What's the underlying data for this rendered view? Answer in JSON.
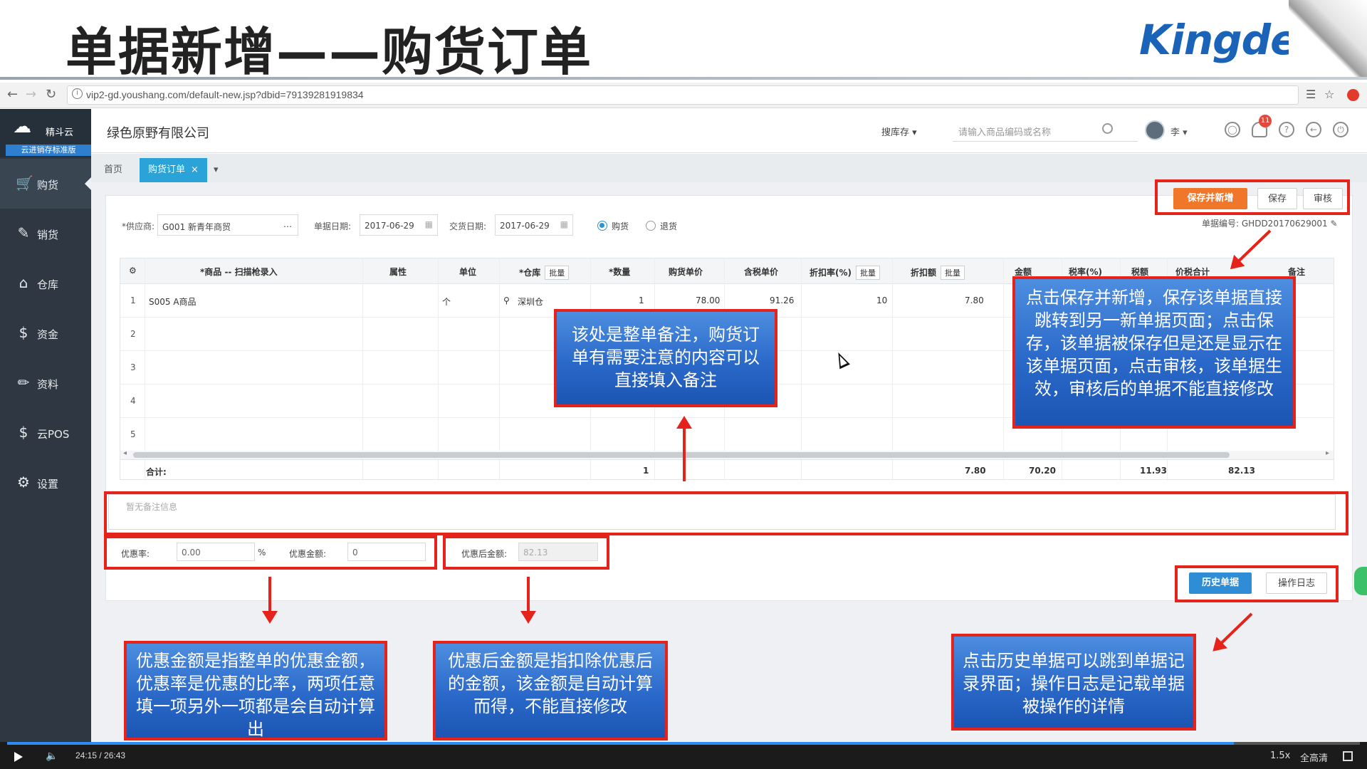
{
  "slide": {
    "title": "单据新增——购货订单",
    "logo": "Kingdee"
  },
  "browser": {
    "url": "vip2-gd.youshang.com/default-new.jsp?dbid=79139281919834"
  },
  "sidebar": {
    "brand_name": "精斗云",
    "brand_sub": "云进销存标准版",
    "items": [
      {
        "label": "购货",
        "icon": "cart-icon"
      },
      {
        "label": "销货",
        "icon": "sales-icon"
      },
      {
        "label": "仓库",
        "icon": "warehouse-icon"
      },
      {
        "label": "资金",
        "icon": "money-icon"
      },
      {
        "label": "资料",
        "icon": "pencil-icon"
      },
      {
        "label": "云POS",
        "icon": "pos-icon"
      },
      {
        "label": "设置",
        "icon": "gear-icon"
      }
    ]
  },
  "header": {
    "company": "绿色原野有限公司",
    "search_type": "搜库存",
    "search_placeholder": "请输入商品编码或名称",
    "user": "李",
    "notification_count": "11"
  },
  "tabs": [
    {
      "label": "首页"
    },
    {
      "label": "购货订单"
    }
  ],
  "form": {
    "supplier_label": "*供应商:",
    "supplier_value": "G001 新青年商贸",
    "doc_date_label": "单据日期:",
    "doc_date_value": "2017-06-29",
    "delivery_date_label": "交货日期:",
    "delivery_date_value": "2017-06-29",
    "radio_purchase": "购货",
    "radio_return": "退货",
    "doc_no_label": "单据编号:",
    "doc_no_value": "GHDD20170629001"
  },
  "toolbar": {
    "save_new": "保存并新增",
    "save": "保存",
    "audit": "审核",
    "history": "历史单据",
    "log": "操作日志"
  },
  "grid": {
    "headers": [
      "*商品 -- 扫描枪录入",
      "属性",
      "单位",
      "*仓库",
      "*数量",
      "购货单价",
      "含税单价",
      "折扣率(%)",
      "折扣额",
      "金额",
      "税率(%)",
      "税额",
      "价税合计",
      "备注"
    ],
    "batch_label": "批量",
    "rows": [
      {
        "no": "1",
        "product": "S005 A商品",
        "unit": "个",
        "warehouse": "深圳仓",
        "qty": "1",
        "price": "78.00",
        "tax_price": "91.26",
        "discount_rate": "10",
        "discount_amount": "7.80"
      },
      {
        "no": "2"
      },
      {
        "no": "3"
      },
      {
        "no": "4"
      },
      {
        "no": "5"
      }
    ],
    "total_label": "合计:",
    "totals": {
      "qty": "1",
      "discount_amount": "7.80",
      "amount": "70.20",
      "tax": "11.93",
      "total": "82.13"
    }
  },
  "remark_placeholder": "暂无备注信息",
  "discount": {
    "rate_label": "优惠率:",
    "rate_value": "0.00",
    "rate_unit": "%",
    "amount_label": "优惠金额:",
    "amount_value": "0",
    "after_label": "优惠后金额:",
    "after_value": "82.13"
  },
  "callouts": {
    "remark": "该处是整单备注，购货订单有需要注意的内容可以直接填入备注",
    "save": "点击保存并新增，保存该单据直接跳转到另一新单据页面；点击保存，该单据被保存但是还是显示在该单据页面，点击审核，该单据生效，审核后的单据不能直接修改",
    "discount": "优惠金额是指整单的优惠金额，优惠率是优惠的比率，两项任意填一项另外一项都是会自动计算出",
    "after_discount": "优惠后金额是指扣除优惠后的金额，该金额是自动计算而得，不能直接修改",
    "history": "点击历史单据可以跳到单据记录界面；操作日志是记载单据被操作的详情"
  },
  "player": {
    "time": "24:15 / 26:43",
    "speed": "1.5x",
    "quality": "全高清",
    "progress": 0.907
  },
  "colors": {
    "highlight": "#e5231b",
    "callout_blue": "#2a69c9",
    "accent_orange": "#f0772a",
    "tab_blue": "#2aa3d8",
    "sidebar": "#2f3842"
  }
}
